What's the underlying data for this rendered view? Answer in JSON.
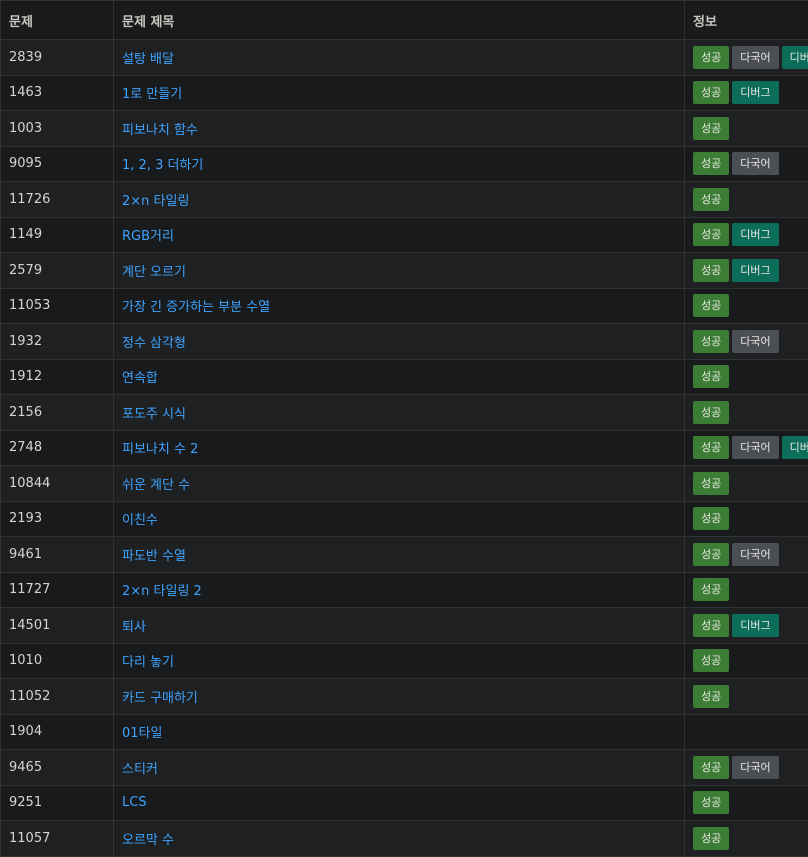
{
  "header": {
    "problem": "문제",
    "title": "문제 제목",
    "info": "정보"
  },
  "badge_labels": {
    "success": "성공",
    "multi": "다국어",
    "debug": "디버그"
  },
  "colors": {
    "success": "#3b7d34",
    "multi": "#4b4f53",
    "debug": "#0b6d5a",
    "link": "#3ea3ff"
  },
  "rows": [
    {
      "id": "2839",
      "title": "설탕 배달",
      "badges": [
        "success",
        "multi",
        "debug"
      ]
    },
    {
      "id": "1463",
      "title": "1로 만들기",
      "badges": [
        "success",
        "debug"
      ]
    },
    {
      "id": "1003",
      "title": "피보나치 함수",
      "badges": [
        "success"
      ]
    },
    {
      "id": "9095",
      "title": "1, 2, 3 더하기",
      "badges": [
        "success",
        "multi"
      ]
    },
    {
      "id": "11726",
      "title": "2×n 타일링",
      "badges": [
        "success"
      ]
    },
    {
      "id": "1149",
      "title": "RGB거리",
      "badges": [
        "success",
        "debug"
      ]
    },
    {
      "id": "2579",
      "title": "계단 오르기",
      "badges": [
        "success",
        "debug"
      ]
    },
    {
      "id": "11053",
      "title": "가장 긴 증가하는 부분 수열",
      "badges": [
        "success"
      ]
    },
    {
      "id": "1932",
      "title": "정수 삼각형",
      "badges": [
        "success",
        "multi"
      ]
    },
    {
      "id": "1912",
      "title": "연속합",
      "badges": [
        "success"
      ]
    },
    {
      "id": "2156",
      "title": "포도주 시식",
      "badges": [
        "success"
      ]
    },
    {
      "id": "2748",
      "title": "피보나치 수 2",
      "badges": [
        "success",
        "multi",
        "debug"
      ]
    },
    {
      "id": "10844",
      "title": "쉬운 계단 수",
      "badges": [
        "success"
      ]
    },
    {
      "id": "2193",
      "title": "이친수",
      "badges": [
        "success"
      ]
    },
    {
      "id": "9461",
      "title": "파도반 수열",
      "badges": [
        "success",
        "multi"
      ]
    },
    {
      "id": "11727",
      "title": "2×n 타일링 2",
      "badges": [
        "success"
      ]
    },
    {
      "id": "14501",
      "title": "퇴사",
      "badges": [
        "success",
        "debug"
      ]
    },
    {
      "id": "1010",
      "title": "다리 놓기",
      "badges": [
        "success"
      ]
    },
    {
      "id": "11052",
      "title": "카드 구매하기",
      "badges": [
        "success"
      ]
    },
    {
      "id": "1904",
      "title": "01타일",
      "badges": []
    },
    {
      "id": "9465",
      "title": "스티커",
      "badges": [
        "success",
        "multi"
      ]
    },
    {
      "id": "9251",
      "title": "LCS",
      "badges": [
        "success"
      ]
    },
    {
      "id": "11057",
      "title": "오르막 수",
      "badges": [
        "success"
      ]
    }
  ]
}
